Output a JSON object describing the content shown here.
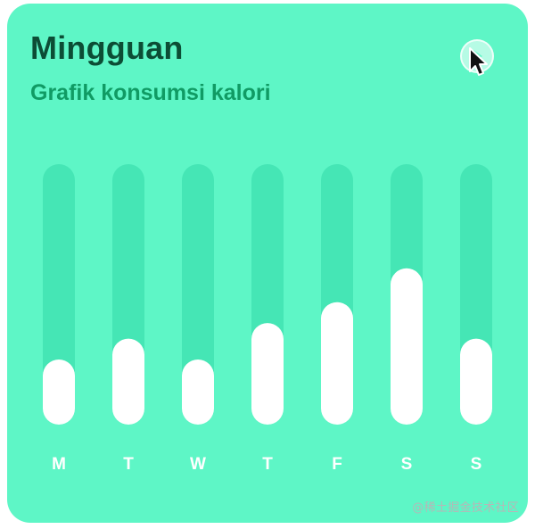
{
  "card": {
    "title": "Mingguan",
    "subtitle": "Grafik konsumsi kalori"
  },
  "colors": {
    "card_bg": "#5EF6C6",
    "track": "#45E6B5",
    "bar": "#FFFFFF",
    "title": "#0C4D35",
    "subtitle": "#109B64",
    "day_label": "#FFFFFF",
    "watermark": "#B7B7B7"
  },
  "icons": {
    "play": "play-icon",
    "cursor": "mouse-cursor-icon"
  },
  "chart_data": {
    "type": "bar",
    "categories": [
      "M",
      "T",
      "W",
      "T",
      "F",
      "S",
      "S"
    ],
    "values": [
      25,
      33,
      25,
      39,
      47,
      60,
      33
    ],
    "ylim": [
      0,
      100
    ],
    "grid": false,
    "title": "",
    "xlabel": "",
    "ylabel": ""
  },
  "watermark": "@稀土掘金技术社区"
}
